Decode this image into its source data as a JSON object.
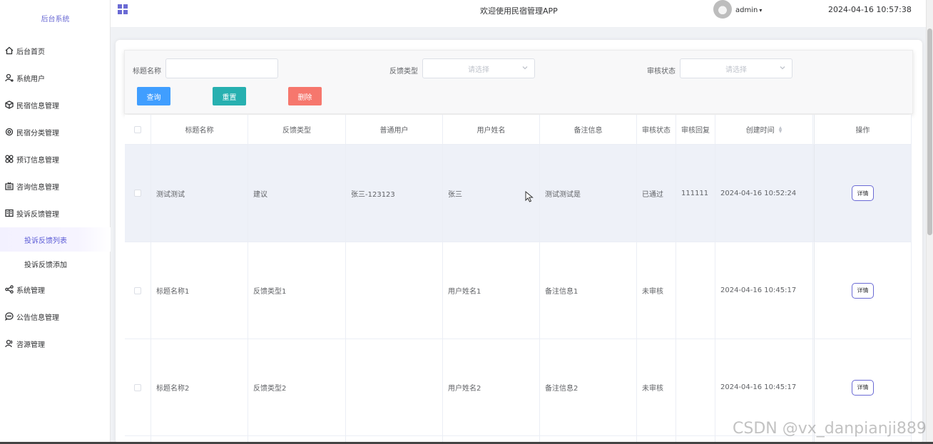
{
  "sidebar": {
    "brand": "后台系统",
    "items": [
      {
        "label": "后台首页",
        "icon": "home-icon"
      },
      {
        "label": "系统用户",
        "icon": "user-icon"
      },
      {
        "label": "民宿信息管理",
        "icon": "cube-icon"
      },
      {
        "label": "民宿分类管理",
        "icon": "gear-icon"
      },
      {
        "label": "预订信息管理",
        "icon": "grid-icon"
      },
      {
        "label": "咨询信息管理",
        "icon": "inbox-icon"
      },
      {
        "label": "投诉反馈管理",
        "icon": "list-icon"
      }
    ],
    "sub_items": [
      {
        "label": "投诉反馈列表",
        "active": true
      },
      {
        "label": "投诉反馈添加",
        "active": false
      }
    ],
    "items_after": [
      {
        "label": "系统管理",
        "icon": "share-icon"
      },
      {
        "label": "公告信息管理",
        "icon": "chat-icon"
      },
      {
        "label": "咨源管理",
        "icon": "user-icon"
      }
    ]
  },
  "header": {
    "title": "欢迎使用民宿管理APP",
    "user": "admin",
    "datetime": "2024-04-16 10:57:38",
    "accent": "#6a6ad4"
  },
  "search": {
    "title_label": "标题名称",
    "title_value": "",
    "type_label": "反馈类型",
    "type_placeholder": "请选择",
    "status_label": "审核状态",
    "status_placeholder": "请选择",
    "query_label": "查询",
    "reset_label": "重置",
    "delete_label": "删除"
  },
  "table": {
    "columns": [
      "标题名称",
      "反馈类型",
      "普通用户",
      "用户姓名",
      "备注信息",
      "审核状态",
      "审核回复",
      "创建时间",
      "操作"
    ],
    "rows": [
      {
        "title": "测试测试",
        "type": "建议",
        "user": "张三-123123",
        "name": "张三",
        "remark": "测试测试是",
        "status": "已通过",
        "reply": "111111",
        "created": "2024-04-16 10:52:24",
        "action": "详情"
      },
      {
        "title": "标题名称1",
        "type": "反馈类型1",
        "user": "",
        "name": "用户姓名1",
        "remark": "备注信息1",
        "status": "未审核",
        "reply": "",
        "created": "2024-04-16 10:45:17",
        "action": "详情"
      },
      {
        "title": "标题名称2",
        "type": "反馈类型2",
        "user": "",
        "name": "用户姓名2",
        "remark": "备注信息2",
        "status": "未审核",
        "reply": "",
        "created": "2024-04-16 10:45:17",
        "action": "详情"
      }
    ]
  },
  "watermark": "CSDN @vx_danpianji889"
}
